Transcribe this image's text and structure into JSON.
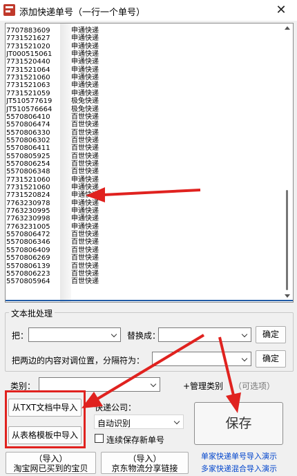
{
  "window": {
    "title": "添加快递单号（一行一个单号）",
    "close_glyph": "✕"
  },
  "list": {
    "lines": [
      {
        "num": "7707883609",
        "name": "申通快递"
      },
      {
        "num": "7731521627",
        "name": "申通快递"
      },
      {
        "num": "7731521020",
        "name": "申通快递"
      },
      {
        "num": "JT000515061",
        "name": "申通快递"
      },
      {
        "num": "7731520440",
        "name": "申通快递"
      },
      {
        "num": "7731521064",
        "name": "申通快递"
      },
      {
        "num": "7731521060",
        "name": "申通快递"
      },
      {
        "num": "7731521063",
        "name": "申通快递"
      },
      {
        "num": "7731521059",
        "name": "申通快递"
      },
      {
        "num": "JT510577619",
        "name": "极兔快递"
      },
      {
        "num": "JT510576664",
        "name": "极兔快递"
      },
      {
        "num": "5570806410",
        "name": "百世快递"
      },
      {
        "num": "5570806474",
        "name": "百世快递"
      },
      {
        "num": "5570806330",
        "name": "百世快递"
      },
      {
        "num": "5570806302",
        "name": "百世快递"
      },
      {
        "num": "5570806411",
        "name": "百世快递"
      },
      {
        "num": "5570805925",
        "name": "百世快递"
      },
      {
        "num": "5570806254",
        "name": "百世快递"
      },
      {
        "num": "5570806348",
        "name": "百世快递"
      },
      {
        "num": "7731521060",
        "name": "申通快递"
      },
      {
        "num": "7731521060",
        "name": "申通快递"
      },
      {
        "num": "7731520824",
        "name": "申通快递"
      },
      {
        "num": "7763230978",
        "name": "申通快递"
      },
      {
        "num": "7763230995",
        "name": "申通快递"
      },
      {
        "num": "7763230998",
        "name": "申通快递"
      },
      {
        "num": "7763231005",
        "name": "申通快递"
      },
      {
        "num": "5570806472",
        "name": "百世快递"
      },
      {
        "num": "5570806346",
        "name": "百世快递"
      },
      {
        "num": "5570806409",
        "name": "百世快递"
      },
      {
        "num": "5570806269",
        "name": "百世快递"
      },
      {
        "num": "5570806139",
        "name": "百世快递"
      },
      {
        "num": "5570806223",
        "name": "百世快递"
      },
      {
        "num": "5570805964",
        "name": "百世快递"
      }
    ]
  },
  "batch": {
    "title": "文本批处理",
    "find_label": "把：",
    "find_value": "",
    "replace_label": "替换成：",
    "replace_value": "",
    "confirm1": "确定",
    "swap_label": "把两边的内容对调位置，分隔符为：",
    "swap_value": "",
    "confirm2": "确定"
  },
  "category": {
    "label": "类别：",
    "value": "",
    "manage_label": "+管理类别",
    "optional_label": "（可选项）"
  },
  "import": {
    "txt_label": "从TXT文档中导入",
    "template_label": "从表格模板中导入",
    "taobao_line1": "（导入）",
    "taobao_line2": "淘宝网已买到的宝贝",
    "jd_line1": "（导入）",
    "jd_line2": "京东物流分享链接"
  },
  "courier": {
    "label": "快递公司：",
    "value": "自动识别",
    "continuous_label": "连续保存新单号",
    "continuous_checked": false
  },
  "save": {
    "label": "保存"
  },
  "links": {
    "single_demo": "单家快递单号导入演示",
    "mixed_demo": "多家快递混合导入演示"
  },
  "colors": {
    "highlight": "#e0221f",
    "link": "#0044cc",
    "scroll_accent": "#1f5aa6"
  }
}
